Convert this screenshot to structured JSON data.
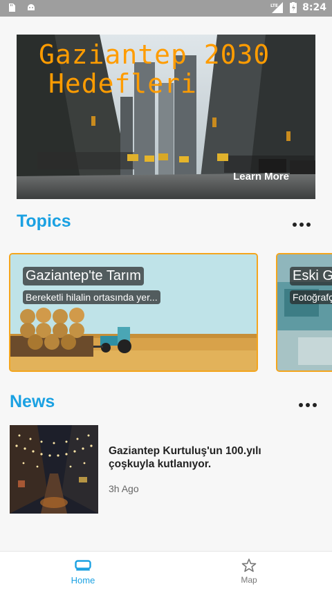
{
  "status_bar": {
    "time": "8:24",
    "network": "LTE"
  },
  "hero": {
    "title_line1": "Gaziantep 2030",
    "title_line2": "Hedefleri",
    "cta": "Learn More"
  },
  "topics": {
    "title": "Topics",
    "cards": [
      {
        "title": "Gaziantep'te Tarım",
        "subtitle": "Bereketli hilalin ortasında yer..."
      },
      {
        "title": "Eski Ga",
        "subtitle": "Fotoğrafç"
      }
    ]
  },
  "news": {
    "title": "News",
    "items": [
      {
        "title": "Gaziantep Kurtuluş'un 100.yılı çoşkuyla kutlanıyor.",
        "time": "3h Ago"
      }
    ]
  },
  "bottom_nav": {
    "items": [
      {
        "label": "Home",
        "icon": "home-icon",
        "active": true
      },
      {
        "label": "Map",
        "icon": "star-icon",
        "active": false
      }
    ]
  },
  "colors": {
    "accent": "#1ba1e2",
    "hero_title": "#ff9c00",
    "card_border": "#f4a51c",
    "status_bar": "#9e9e9e"
  }
}
